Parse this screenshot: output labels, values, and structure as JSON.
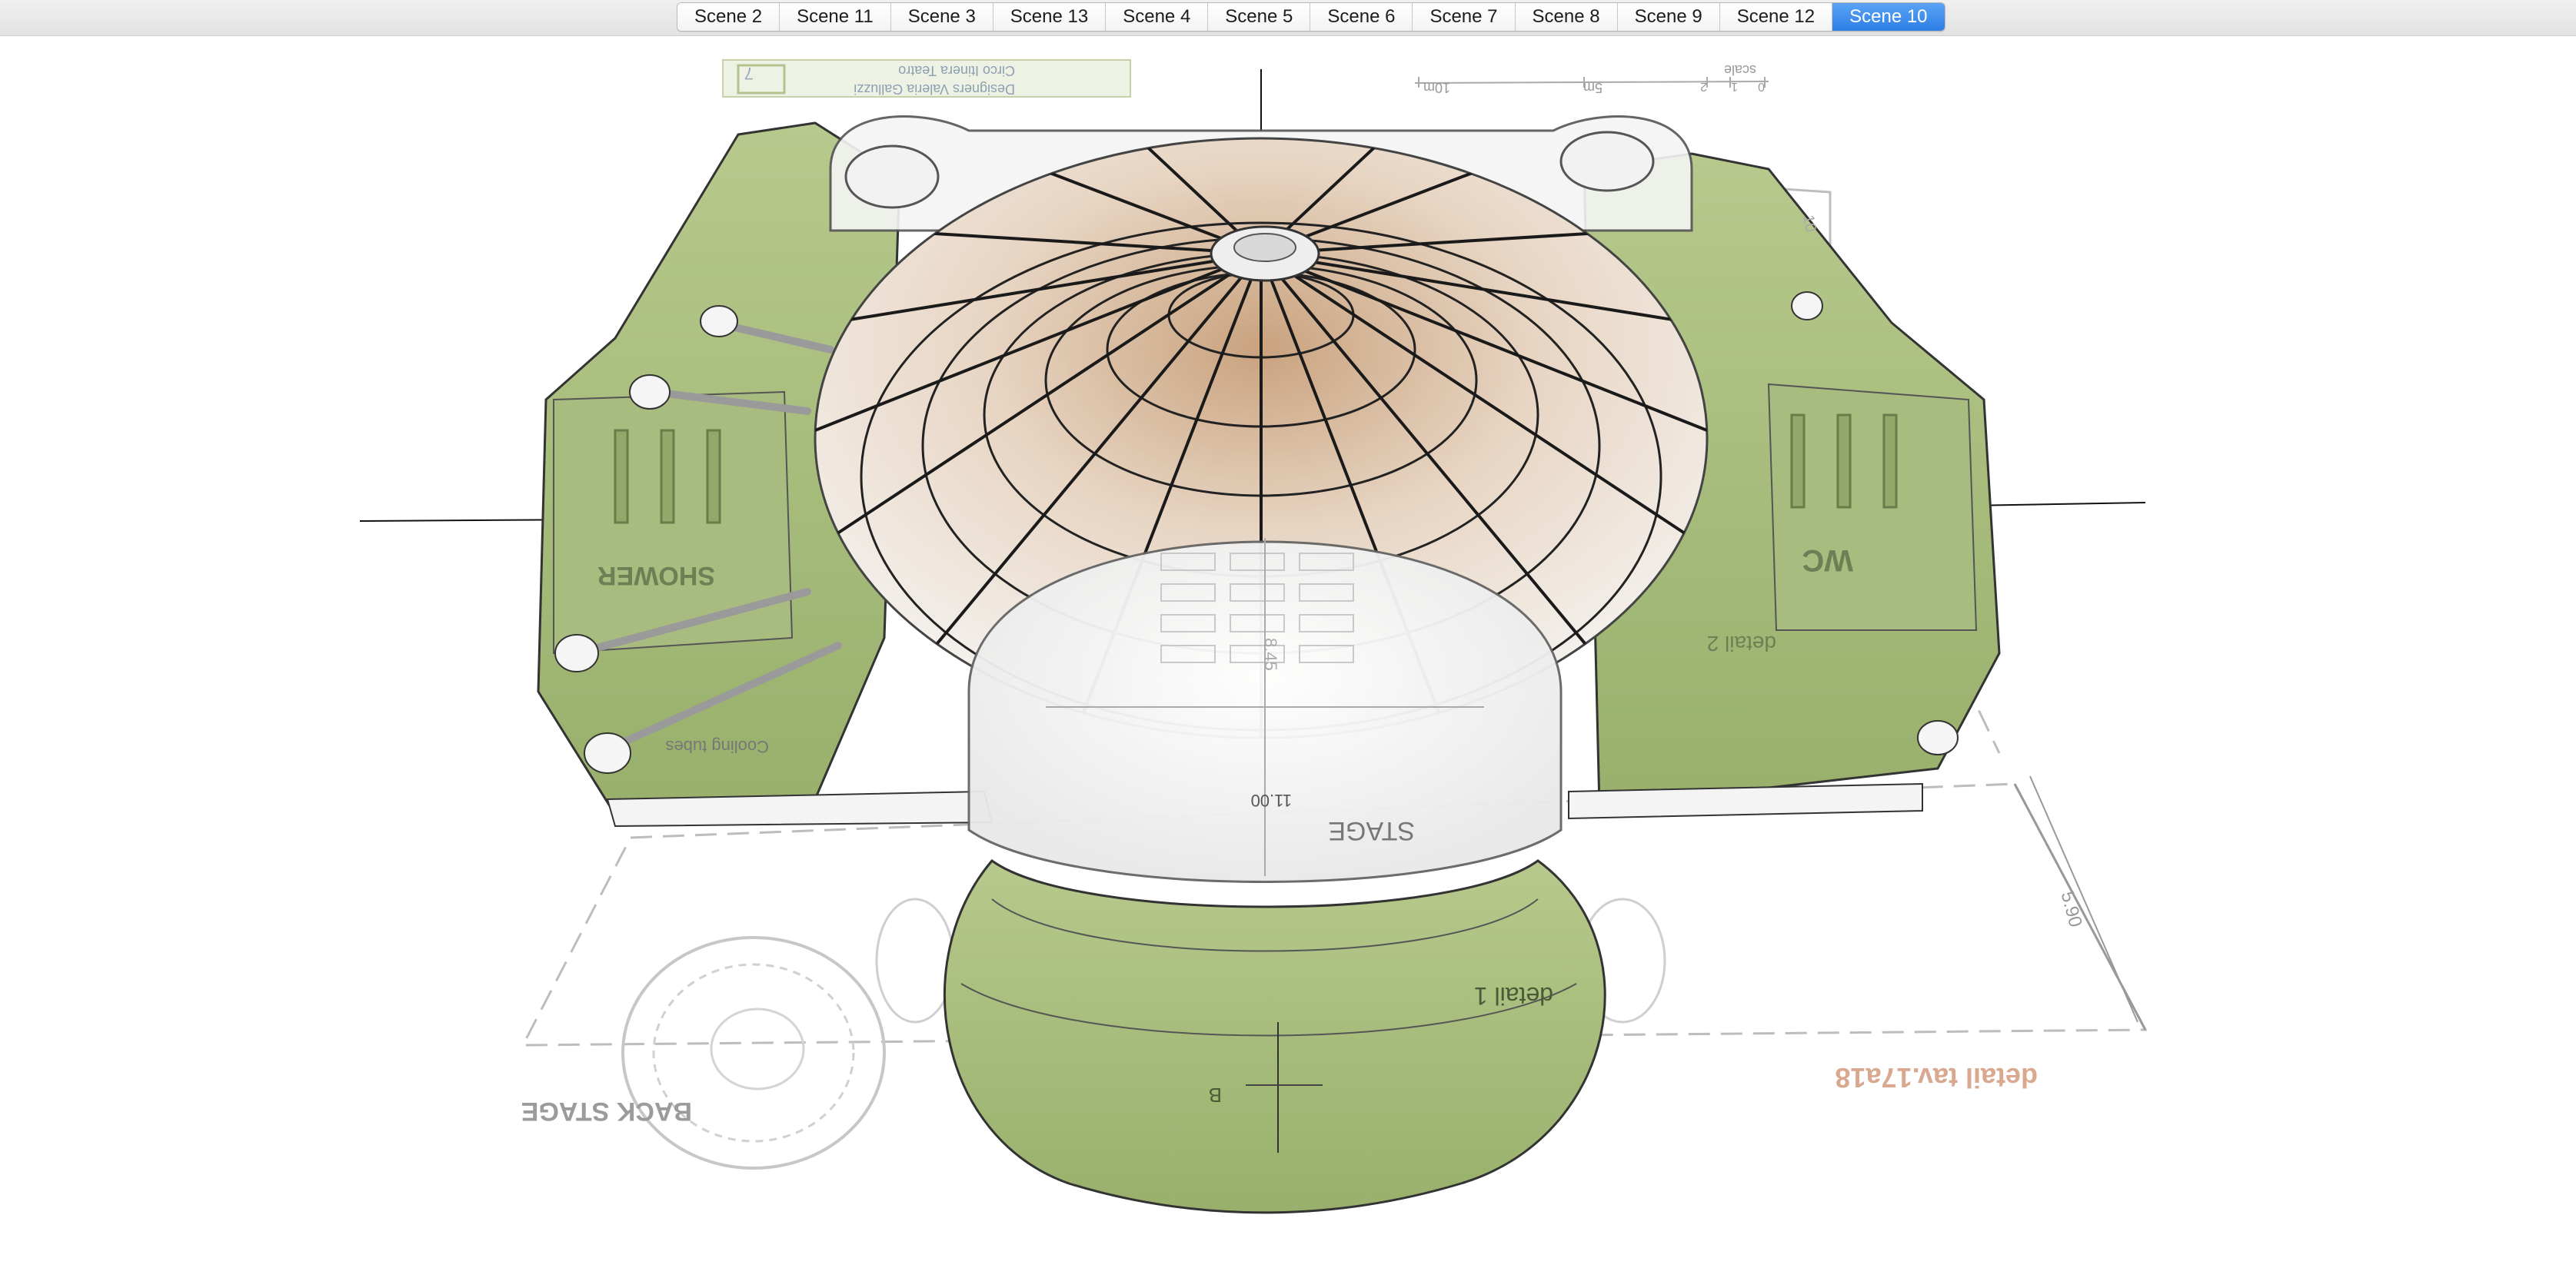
{
  "scene_tabs": [
    {
      "label": "Scene 2"
    },
    {
      "label": "Scene 11"
    },
    {
      "label": "Scene 3"
    },
    {
      "label": "Scene 13"
    },
    {
      "label": "Scene 4"
    },
    {
      "label": "Scene 5"
    },
    {
      "label": "Scene 6"
    },
    {
      "label": "Scene 7"
    },
    {
      "label": "Scene 8"
    },
    {
      "label": "Scene 9"
    },
    {
      "label": "Scene 12"
    },
    {
      "label": "Scene 10"
    }
  ],
  "active_tab": "Scene 10",
  "colors": {
    "accent": "#3b8cf0",
    "green": "#a8bd7c",
    "wood": "#8a5a34"
  },
  "drawing": {
    "title_block_line1": "Circo Itinera Teatro",
    "title_block_line2": "Designers Valeria Galluzzi",
    "title_block_number": "7",
    "scale_label": "scale",
    "scale_0": "0",
    "scale_1": "1",
    "scale_2": "2",
    "scale_5m": "5m",
    "scale_10m": "10m",
    "label_shower": "SHOWER",
    "label_wc": "WC",
    "label_stage": "STAGE",
    "label_back_stage": "BACK STAGE",
    "label_cooling": "Cooling tubes",
    "label_detail1": "detail 1",
    "label_detail2": "detail 2",
    "label_detail_tav": "detail tav.17a18",
    "dim_1100": "11.00",
    "dim_845": "8.45",
    "dim_590": "5.90",
    "dim_10": "10",
    "label_b": "B"
  }
}
